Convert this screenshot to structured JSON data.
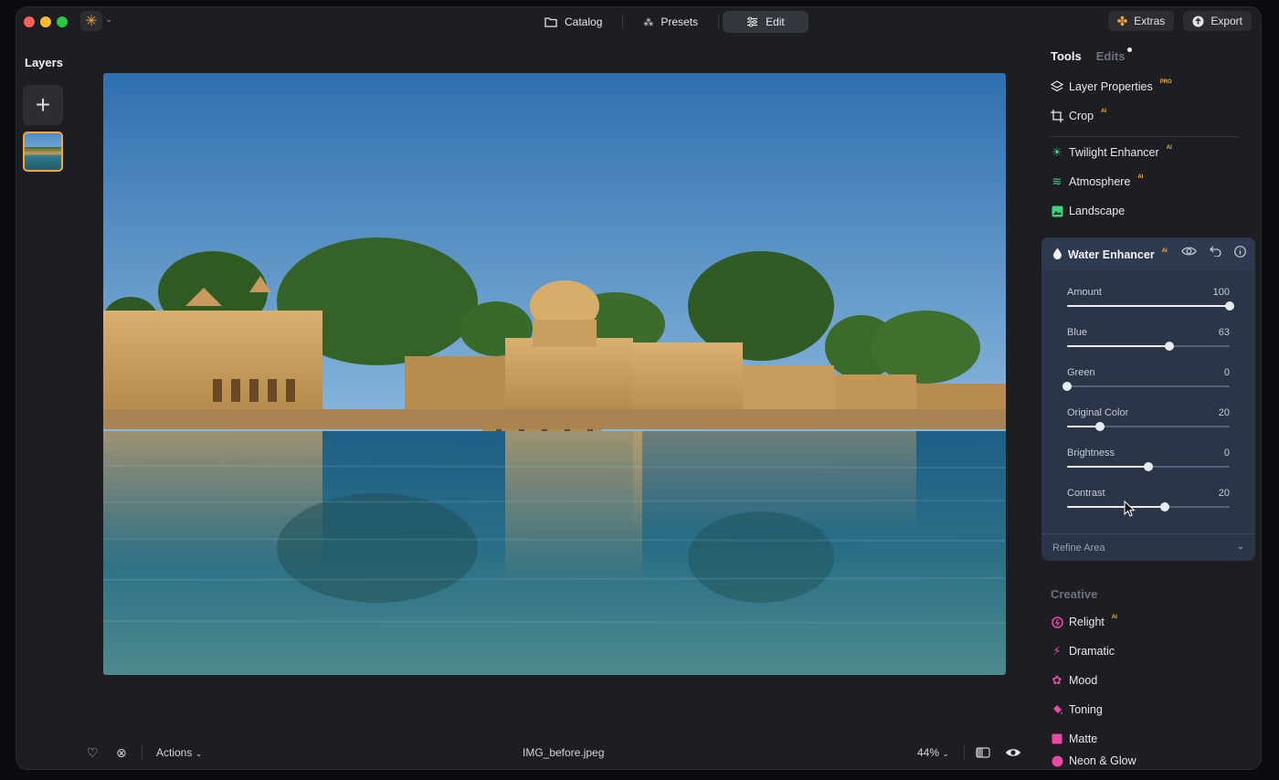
{
  "titlebar": {
    "nav": [
      {
        "label": "Catalog",
        "icon": "folder-icon"
      },
      {
        "label": "Presets",
        "icon": "sparkle-icon"
      },
      {
        "label": "Edit",
        "icon": "sliders-icon",
        "active": true
      }
    ],
    "extras_label": "Extras",
    "export_label": "Export"
  },
  "layers": {
    "title": "Layers"
  },
  "bottombar": {
    "actions_label": "Actions",
    "filename": "IMG_before.jpeg",
    "zoom": "44%"
  },
  "panel": {
    "tabs": {
      "tools": "Tools",
      "edits": "Edits"
    },
    "essentials": [
      {
        "label": "Layer Properties",
        "tag": "PRO",
        "icon": "layers-icon"
      },
      {
        "label": "Crop",
        "tag": "AI",
        "icon": "crop-icon"
      }
    ],
    "landscape": [
      {
        "label": "Twilight Enhancer",
        "tag": "AI",
        "icon": "sunset-icon"
      },
      {
        "label": "Atmosphere",
        "tag": "AI",
        "icon": "waves-icon"
      },
      {
        "label": "Landscape",
        "tag": "",
        "icon": "image-icon"
      }
    ],
    "water_enhancer": {
      "title": "Water Enhancer",
      "tag": "AI",
      "sliders": [
        {
          "label": "Amount",
          "value": "100",
          "fraction": 1.0
        },
        {
          "label": "Blue",
          "value": "63",
          "fraction": 0.63
        },
        {
          "label": "Green",
          "value": "0",
          "fraction": 0.0
        },
        {
          "label": "Original Color",
          "value": "20",
          "fraction": 0.2
        },
        {
          "label": "Brightness",
          "value": "0",
          "fraction": 0.5
        },
        {
          "label": "Contrast",
          "value": "20",
          "fraction": 0.6
        }
      ],
      "refine_label": "Refine Area"
    },
    "creative_title": "Creative",
    "creative": [
      {
        "label": "Relight",
        "tag": "AI",
        "icon": "relight-icon"
      },
      {
        "label": "Dramatic",
        "tag": "",
        "icon": "bolt-icon"
      },
      {
        "label": "Mood",
        "tag": "",
        "icon": "flower-icon"
      },
      {
        "label": "Toning",
        "tag": "",
        "icon": "paint-icon"
      },
      {
        "label": "Matte",
        "tag": "",
        "icon": "square-icon"
      },
      {
        "label": "Neon & Glow",
        "tag": "",
        "icon": "circle-icon"
      }
    ]
  },
  "colors": {
    "accent": "#f3a53a",
    "panel_card": "#2a3548",
    "creative_icons": "#e84aa6",
    "landscape_icons": "#3fd27a"
  }
}
